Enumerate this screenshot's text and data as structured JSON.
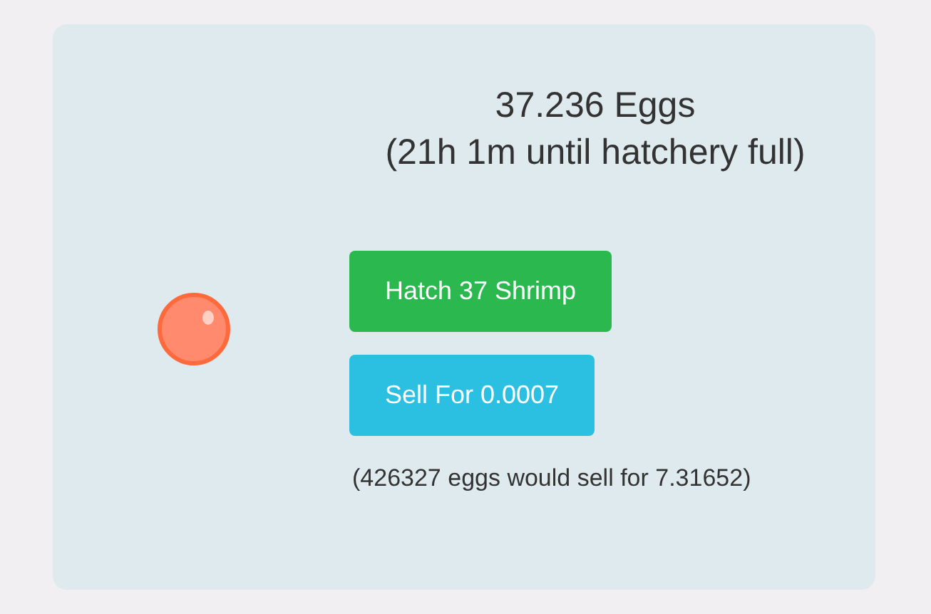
{
  "status": {
    "eggs": "37.236 Eggs",
    "until_full": "(21h 1m until hatchery full)"
  },
  "buttons": [
    {
      "label": "Hatch 37 Shrimp",
      "kind": "hatch"
    },
    {
      "label": "Sell For 0.0007",
      "kind": "sell"
    }
  ],
  "note": "(426327 eggs would sell for 7.31652)"
}
